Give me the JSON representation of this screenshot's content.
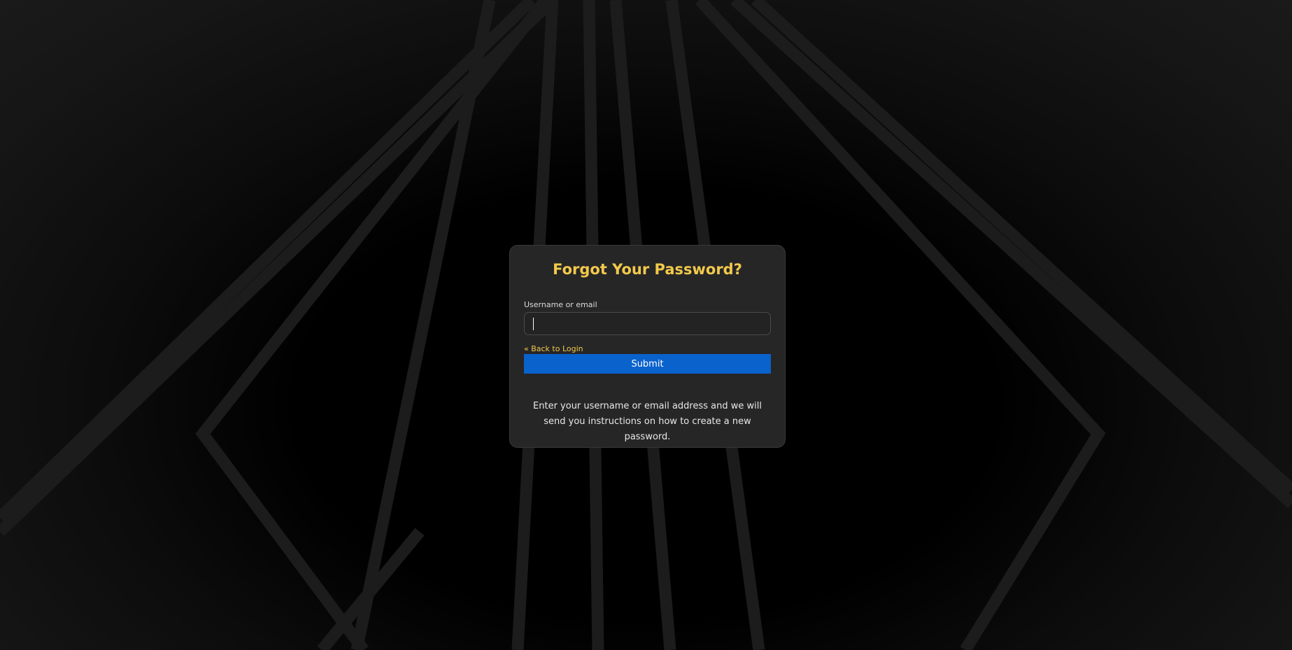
{
  "form": {
    "title": "Forgot Your Password?",
    "field_label": "Username or email",
    "field_value": "",
    "field_placeholder": "",
    "back_link": "« Back to Login",
    "submit_label": "Submit",
    "info_text": "Enter your username or email address and we will send you instructions on how to create a new password."
  },
  "colors": {
    "accent": "#f2c94c",
    "button": "#0a62cc",
    "card": "#262626",
    "background": "#000000"
  }
}
